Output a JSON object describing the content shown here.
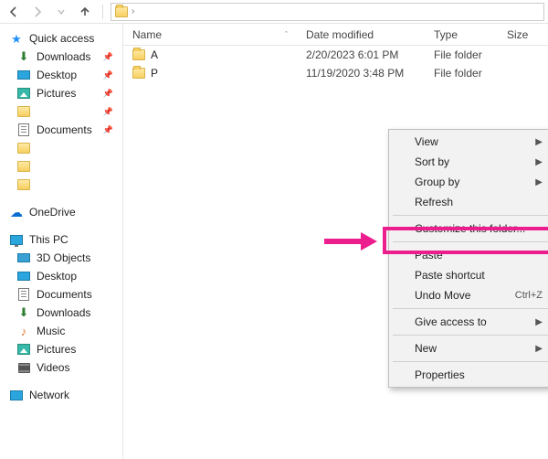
{
  "toolbar": {
    "back": "←",
    "forward": "→",
    "up": "↑"
  },
  "columns": {
    "name": "Name",
    "date": "Date modified",
    "type": "Type",
    "size": "Size"
  },
  "rows": [
    {
      "name": "A",
      "date": "2/20/2023 6:01 PM",
      "type": "File folder"
    },
    {
      "name": "P",
      "date": "11/19/2020 3:48 PM",
      "type": "File folder"
    }
  ],
  "nav": {
    "quick_access": "Quick access",
    "downloads": "Downloads",
    "desktop": "Desktop",
    "pictures": "Pictures",
    "documents": "Documents",
    "onedrive": "OneDrive",
    "this_pc": "This PC",
    "objects3d": "3D Objects",
    "desktop2": "Desktop",
    "documents2": "Documents",
    "downloads2": "Downloads",
    "music": "Music",
    "pictures2": "Pictures",
    "videos": "Videos",
    "network": "Network"
  },
  "context_menu": {
    "view": "View",
    "sort_by": "Sort by",
    "group_by": "Group by",
    "refresh": "Refresh",
    "customize": "Customize this folder...",
    "paste": "Paste",
    "paste_shortcut": "Paste shortcut",
    "undo_move": "Undo Move",
    "undo_move_key": "Ctrl+Z",
    "give_access": "Give access to",
    "new": "New",
    "properties": "Properties"
  }
}
